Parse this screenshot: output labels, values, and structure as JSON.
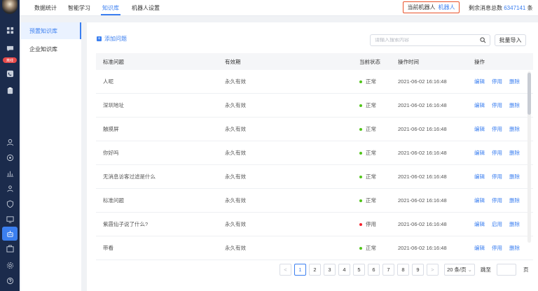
{
  "top_nav": {
    "tabs": [
      {
        "label": "数据统计",
        "active": false
      },
      {
        "label": "智能学习",
        "active": false
      },
      {
        "label": "知识库",
        "active": true
      },
      {
        "label": "机器人设置",
        "active": false
      }
    ],
    "robot_label": "当前机器人",
    "robot_value": "机器人",
    "remaining_label": "剩余消息总数",
    "remaining_value": "6347141",
    "remaining_unit": "条"
  },
  "left_nav": {
    "badge": "离线",
    "icons": [
      "dashboard-icon",
      "chat-icon",
      "phone-icon",
      "clipboard-icon",
      "user-icon",
      "support-icon",
      "stats-icon",
      "contacts-icon",
      "shield-icon",
      "monitor-icon",
      "robot-icon",
      "team-icon",
      "settings-icon",
      "help-icon"
    ]
  },
  "kb_sidebar": {
    "items": [
      {
        "label": "预置知识库",
        "active": true
      },
      {
        "label": "企业知识库",
        "active": false
      }
    ]
  },
  "toolbar": {
    "add_label": "添加问题",
    "search_placeholder": "请输入搜索内容",
    "import_label": "批量导入"
  },
  "table": {
    "headers": [
      "标准问题",
      "有效期",
      "当前状态",
      "操作时间",
      "操作"
    ],
    "rows": [
      {
        "question": "人呢",
        "validity": "永久有效",
        "status": "正常",
        "status_color": "#52c41a",
        "time": "2021-06-02 16:16:48",
        "ops": [
          "编辑",
          "停用",
          "删除"
        ]
      },
      {
        "question": "深圳地址",
        "validity": "永久有效",
        "status": "正常",
        "status_color": "#52c41a",
        "time": "2021-06-02 16:16:48",
        "ops": [
          "编辑",
          "停用",
          "删除"
        ]
      },
      {
        "question": "触摸屏",
        "validity": "永久有效",
        "status": "正常",
        "status_color": "#52c41a",
        "time": "2021-06-02 16:16:48",
        "ops": [
          "编辑",
          "停用",
          "删除"
        ]
      },
      {
        "question": "你好吗",
        "validity": "永久有效",
        "status": "正常",
        "status_color": "#52c41a",
        "time": "2021-06-02 16:16:48",
        "ops": [
          "编辑",
          "停用",
          "删除"
        ]
      },
      {
        "question": "无消息访客过滤是什么",
        "validity": "永久有效",
        "status": "正常",
        "status_color": "#52c41a",
        "time": "2021-06-02 16:16:48",
        "ops": [
          "编辑",
          "停用",
          "删除"
        ]
      },
      {
        "question": "标准问题",
        "validity": "永久有效",
        "status": "正常",
        "status_color": "#52c41a",
        "time": "2021-06-02 16:16:48",
        "ops": [
          "编辑",
          "停用",
          "删除"
        ]
      },
      {
        "question": "紫霞仙子说了什么?",
        "validity": "永久有效",
        "status": "停用",
        "status_color": "#f5222d",
        "time": "2021-06-02 16:16:48",
        "ops": [
          "编辑",
          "启用",
          "删除"
        ]
      },
      {
        "question": "带看",
        "validity": "永久有效",
        "status": "正常",
        "status_color": "#52c41a",
        "time": "2021-06-02 16:16:48",
        "ops": [
          "编辑",
          "停用",
          "删除"
        ]
      }
    ]
  },
  "pagination": {
    "prev": "<",
    "pages": [
      "1",
      "2",
      "3",
      "4",
      "5",
      "6",
      "7",
      "8",
      "9"
    ],
    "current": "1",
    "next": ">",
    "per_page": "20 条/页",
    "goto_label": "跳至",
    "page_unit": "页"
  },
  "colors": {
    "accent": "#3b7ff0",
    "nav_bg": "#1b2b4c",
    "highlight_border": "#e9532b"
  }
}
